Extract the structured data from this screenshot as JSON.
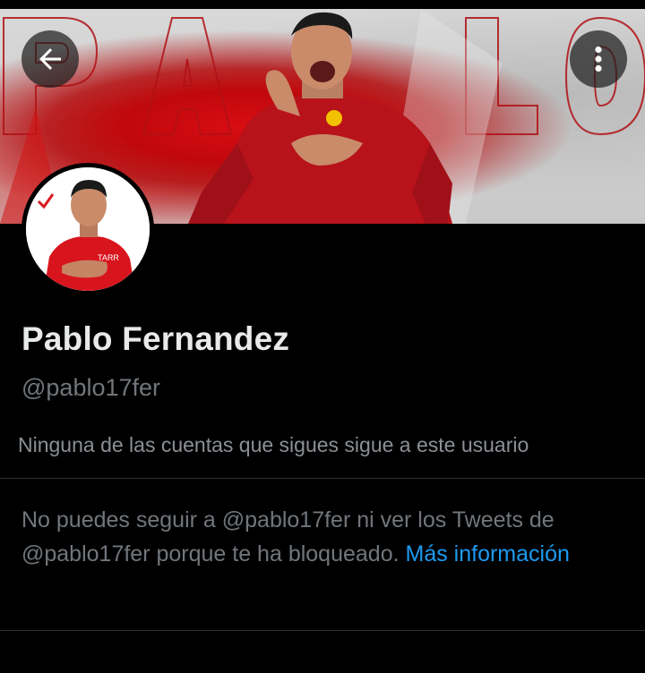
{
  "profile": {
    "banner_text": "PABLO",
    "name": "Pablo Fernandez",
    "handle": "@pablo17fer",
    "followers_note": "Ninguna de las cuentas que sigues sigue a este usuario"
  },
  "blocked_notice": {
    "text": "No puedes seguir a @pablo17fer ni ver los Tweets de @pablo17fer porque te ha bloqueado.",
    "link": "Más información"
  },
  "icons": {
    "back": "arrow-left-icon",
    "more": "vertical-ellipsis-icon"
  },
  "colors": {
    "background": "#000000",
    "text": "#e7e9ea",
    "muted": "#71767b",
    "link": "#1d9bf0",
    "accent_red": "#d80d12"
  }
}
